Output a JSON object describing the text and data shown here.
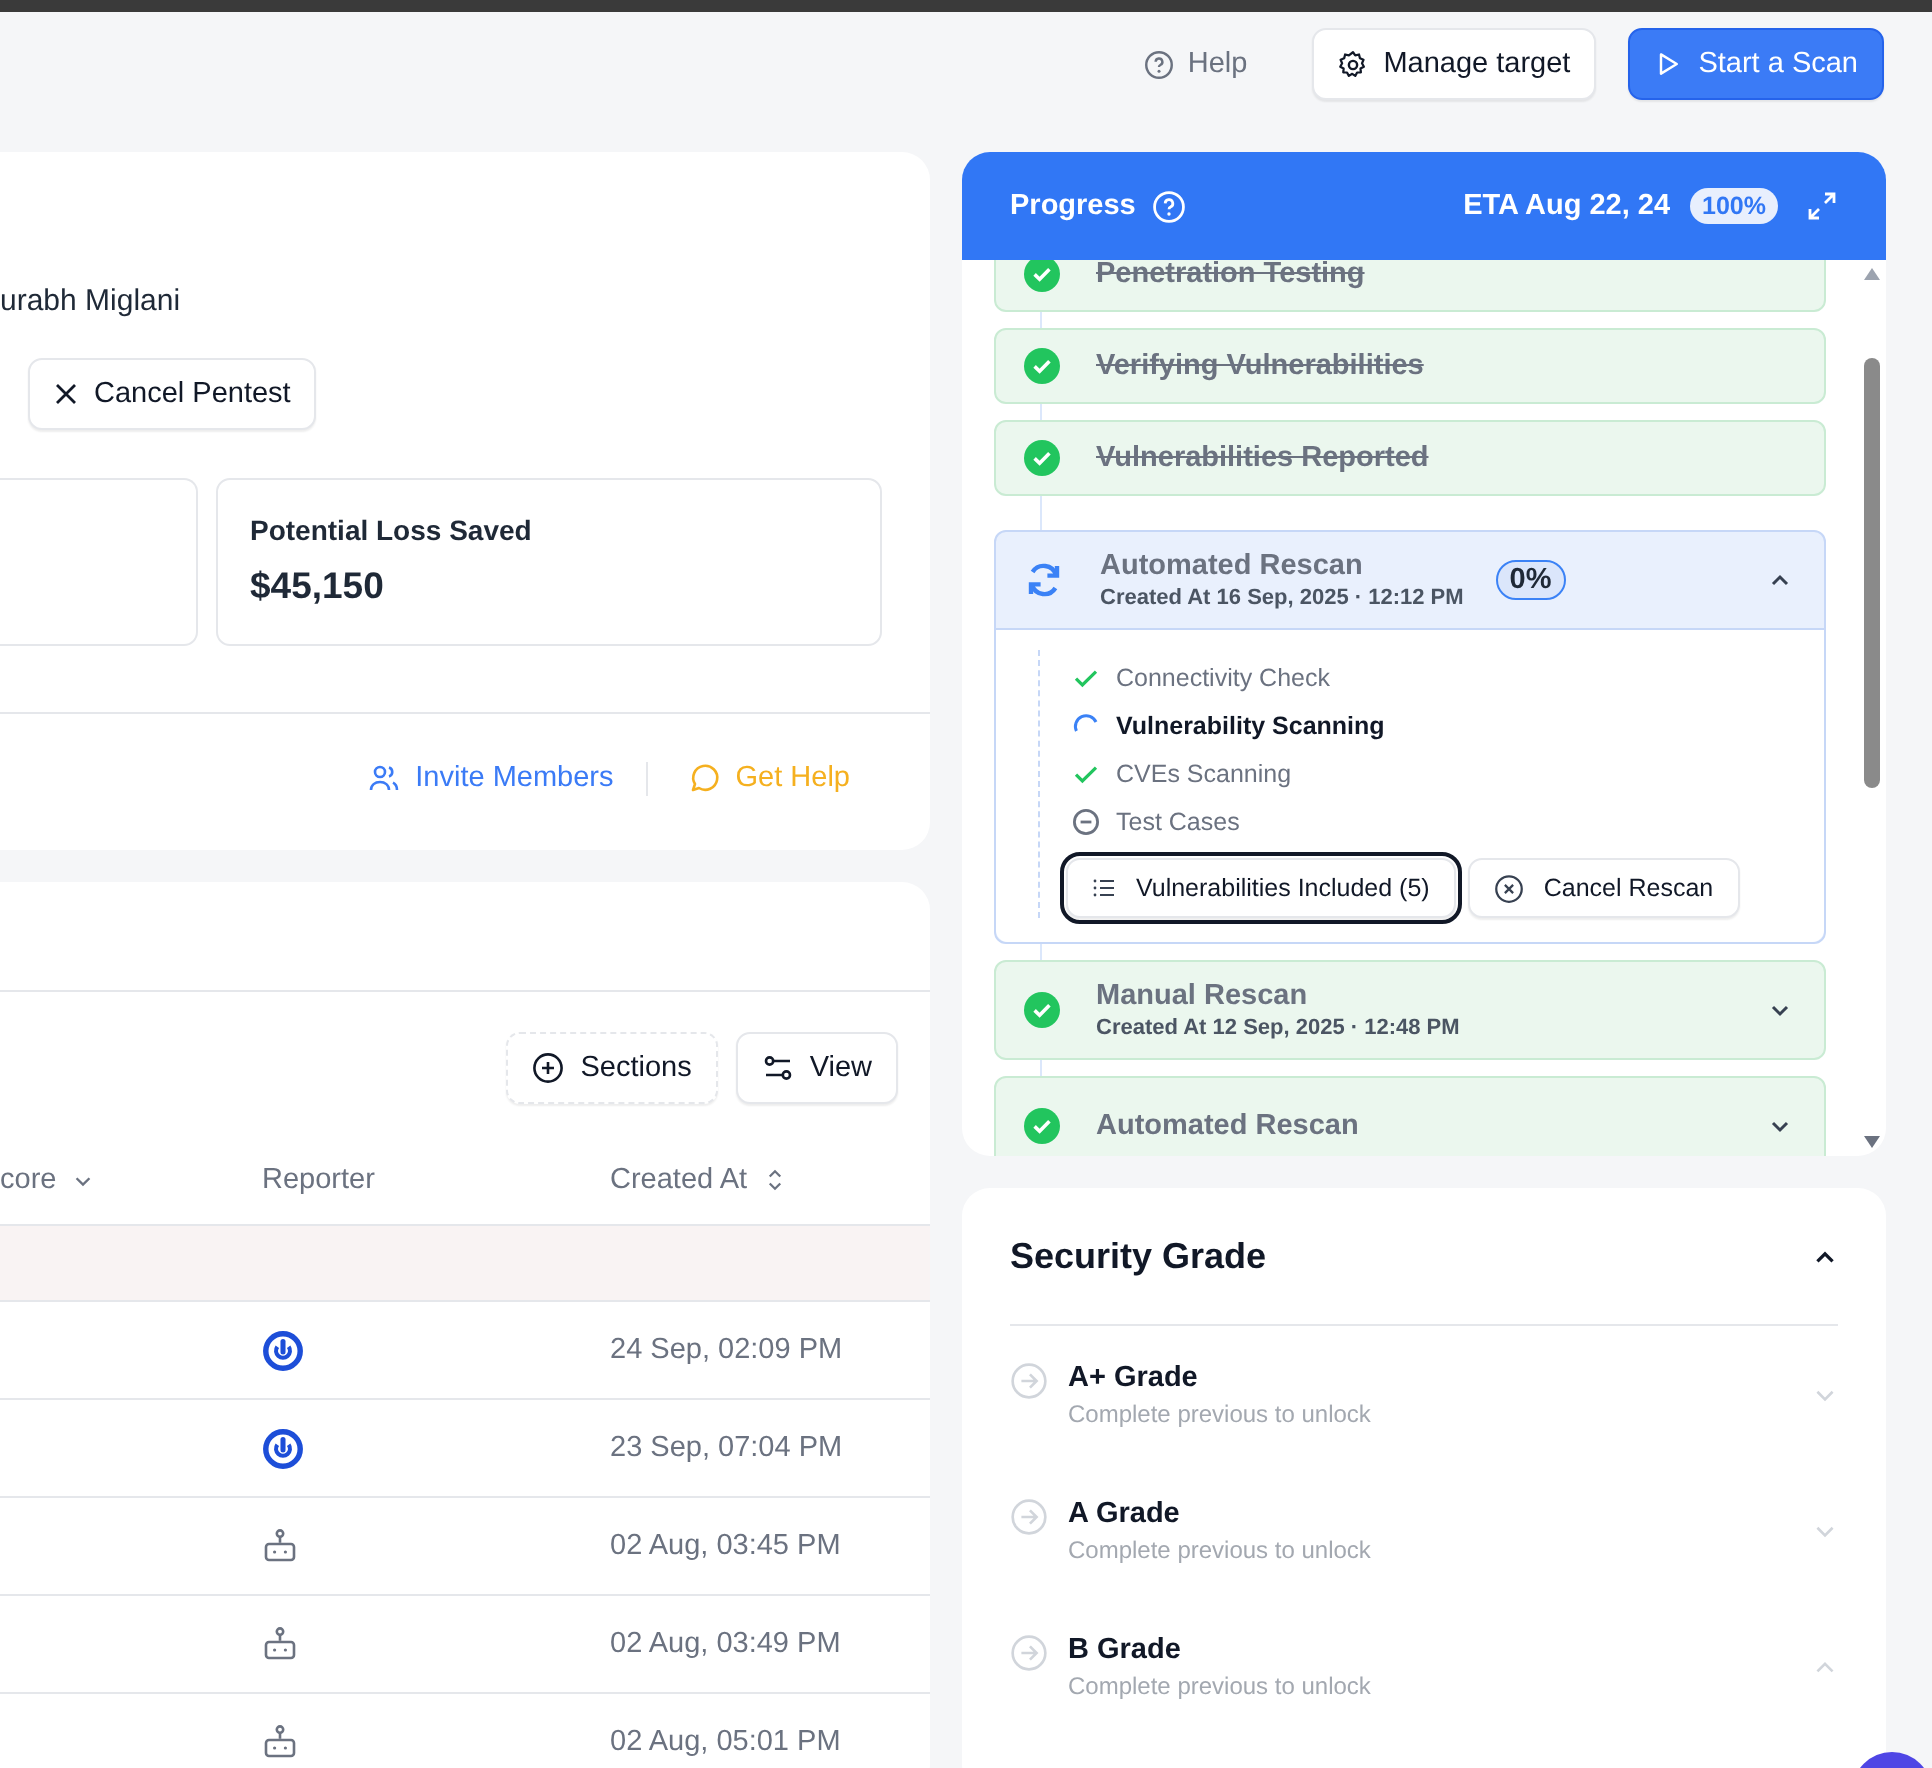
{
  "header": {
    "help": "Help",
    "manage_target": "Manage target",
    "start_scan": "Start a Scan"
  },
  "overview": {
    "owner": "urabh Miglani",
    "cancel_button": "Cancel Pentest",
    "stat": {
      "label": "Potential Loss Saved",
      "value": "$45,150"
    },
    "links": [
      {
        "label": "Invite Members",
        "kind": "invite"
      },
      {
        "label": "Get Help",
        "kind": "help"
      }
    ]
  },
  "findings": {
    "buttons": [
      {
        "label": "Sections",
        "kind": "sections"
      },
      {
        "label": "View",
        "kind": "view"
      }
    ],
    "columns": [
      {
        "label": "core",
        "kind": "dropdown"
      },
      {
        "label": "Reporter",
        "kind": "plain"
      },
      {
        "label": "Created At",
        "kind": "sortable"
      }
    ],
    "rows": [
      {
        "kind": "user",
        "created": "24 Sep, 02:09 PM"
      },
      {
        "kind": "user",
        "created": "23 Sep, 07:04 PM"
      },
      {
        "kind": "bot",
        "created": "02 Aug, 03:45 PM"
      },
      {
        "kind": "bot",
        "created": "02 Aug, 03:49 PM"
      },
      {
        "kind": "bot",
        "created": "02 Aug, 05:01 PM"
      }
    ]
  },
  "progress": {
    "title": "Progress",
    "eta": "ETA Aug 22, 24",
    "percent": "100%",
    "steps": [
      {
        "kind": "stage",
        "title": "Penetration Testing",
        "done": true
      },
      {
        "kind": "stage",
        "title": "Verifying Vulnerabilities",
        "done": true
      },
      {
        "kind": "stage",
        "title": "Vulnerabilities Reported",
        "done": true
      },
      {
        "kind": "rescan",
        "title": "Automated Rescan",
        "created": "Created At 16 Sep, 2025 · 12:12 PM",
        "done": false,
        "percent": "0%",
        "expanded": true,
        "tasks": [
          {
            "label": "Connectivity Check",
            "kind": "done"
          },
          {
            "label": "Vulnerability Scanning",
            "kind": "running"
          },
          {
            "label": "CVEs Scanning",
            "kind": "done"
          },
          {
            "label": "Test Cases",
            "kind": "skipped"
          }
        ],
        "actions": [
          {
            "label": "Vulnerabilities Included (5)",
            "kind": "list",
            "focused": true
          },
          {
            "label": "Cancel Rescan",
            "kind": "cancel",
            "focused": false
          }
        ]
      },
      {
        "kind": "rescan",
        "title": "Manual Rescan",
        "created": "Created At 12 Sep, 2025 · 12:48 PM",
        "done": true,
        "expanded": false
      },
      {
        "kind": "rescan",
        "title": "Automated Rescan",
        "done": true,
        "expanded": false
      }
    ]
  },
  "grades": {
    "title": "Security Grade",
    "expanded": true,
    "items": [
      {
        "title": "A+ Grade",
        "note": "Complete previous to unlock",
        "expanded": false
      },
      {
        "title": "A Grade",
        "note": "Complete previous to unlock",
        "expanded": false
      },
      {
        "title": "B Grade",
        "note": "Complete previous to unlock",
        "expanded": true
      }
    ]
  }
}
